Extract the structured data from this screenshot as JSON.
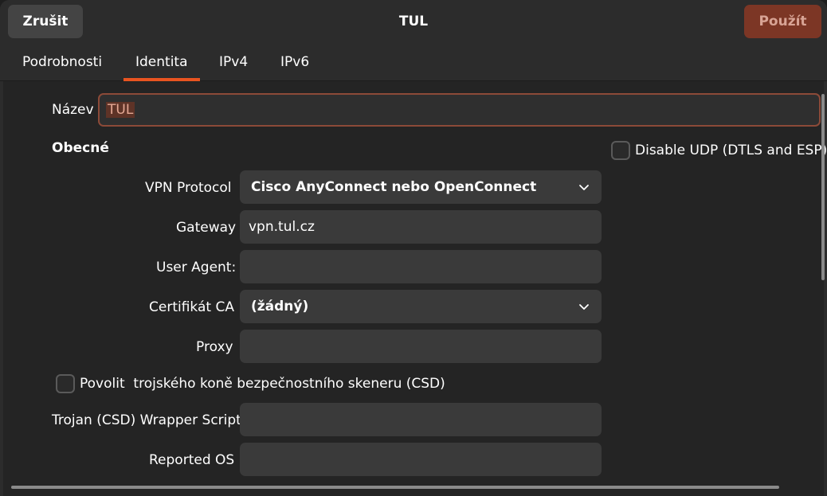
{
  "header": {
    "cancel_label": "Zrušit",
    "title": "TUL",
    "apply_label": "Použít"
  },
  "tabs": [
    {
      "label": "Podrobnosti"
    },
    {
      "label": "Identita",
      "active": true
    },
    {
      "label": "IPv4"
    },
    {
      "label": "IPv6"
    }
  ],
  "identity": {
    "name_label": "Název",
    "name_value": "TUL"
  },
  "general": {
    "section_title": "Obecné",
    "disable_udp_label": "Disable UDP (DTLS and ESP)",
    "disable_udp_checked": false,
    "vpn_protocol_label": "VPN Protocol",
    "vpn_protocol_value": "Cisco AnyConnect nebo OpenConnect",
    "gateway_label": "Gateway",
    "gateway_value": "vpn.tul.cz",
    "user_agent_label": "User Agent:",
    "user_agent_value": "",
    "ca_cert_label": "Certifikát CA",
    "ca_cert_value": "(žádný)",
    "proxy_label": "Proxy",
    "proxy_value": "",
    "csd_label": "Povolit  trojského koně bezpečnostního skeneru (CSD)",
    "csd_checked": false,
    "csd_wrapper_label": "Trojan (CSD) Wrapper Script",
    "csd_wrapper_value": "",
    "reported_os_label": "Reported OS",
    "reported_os_value": ""
  },
  "colors": {
    "accent": "#e95420",
    "apply_bg": "#7c3625",
    "field_bg": "#3a3a3a",
    "window_bg": "#242424"
  },
  "icons": [
    "chevron-down-icon",
    "checkbox-icon"
  ]
}
